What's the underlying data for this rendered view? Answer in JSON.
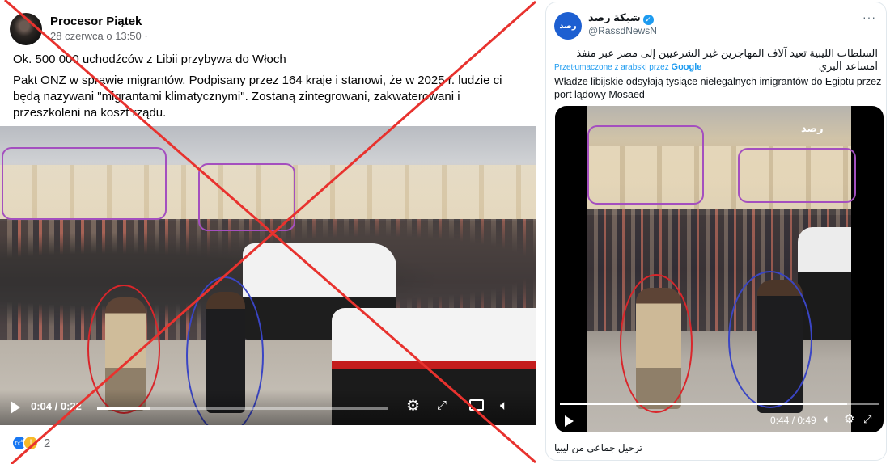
{
  "facebook_post": {
    "author": "Procesor Piątek",
    "date": "28 czerwca o 13:50 ·",
    "text_line_1": "Ok. 500 000 uchodźców z Libii przybywa do Włoch",
    "text_line_2": "Pakt ONZ w sprawie migrantów. Podpisany przez 164 kraje i stanowi, że w 2025 r. ludzie ci będą nazywani \"migrantami klimatycznymi\". Zostaną zintegrowani, zakwaterowani i przeszkoleni na koszt rządu.",
    "video": {
      "time": "0:04 / 0:22",
      "progress": 0.18
    },
    "reaction_count": "2",
    "crossed_out_color": "#e8322e"
  },
  "x_post": {
    "display_name": "شبكة رصد",
    "handle": "@RassdNewsN",
    "avatar_text": "رصد",
    "arabic_text": "السلطات الليبية تعيد آلاف المهاجرين غير الشرعيين إلى مصر عبر منفذ امساعد البري",
    "translated_label": "Przetłumaczone z arabski przez",
    "translator": "Google",
    "translation": "Władze libijskie odsyłają tysiące nielegalnych imigrantów do Egiptu przez port lądowy Mosaed",
    "video": {
      "watermark": "رصد",
      "time": "0:44 / 0:49",
      "progress": 0.9
    },
    "caption": "ترحيل جماعي من ليبيا"
  },
  "annotation_colors": {
    "purple": "#a44fbf",
    "red": "#d9262b",
    "blue": "#3a45c4"
  },
  "icons": [
    "play-icon",
    "settings-gear-icon",
    "fullscreen-icon",
    "pip-icon",
    "volume-icon",
    "verified-badge-icon",
    "more-options-icon",
    "like-reaction-icon",
    "wow-reaction-icon"
  ]
}
